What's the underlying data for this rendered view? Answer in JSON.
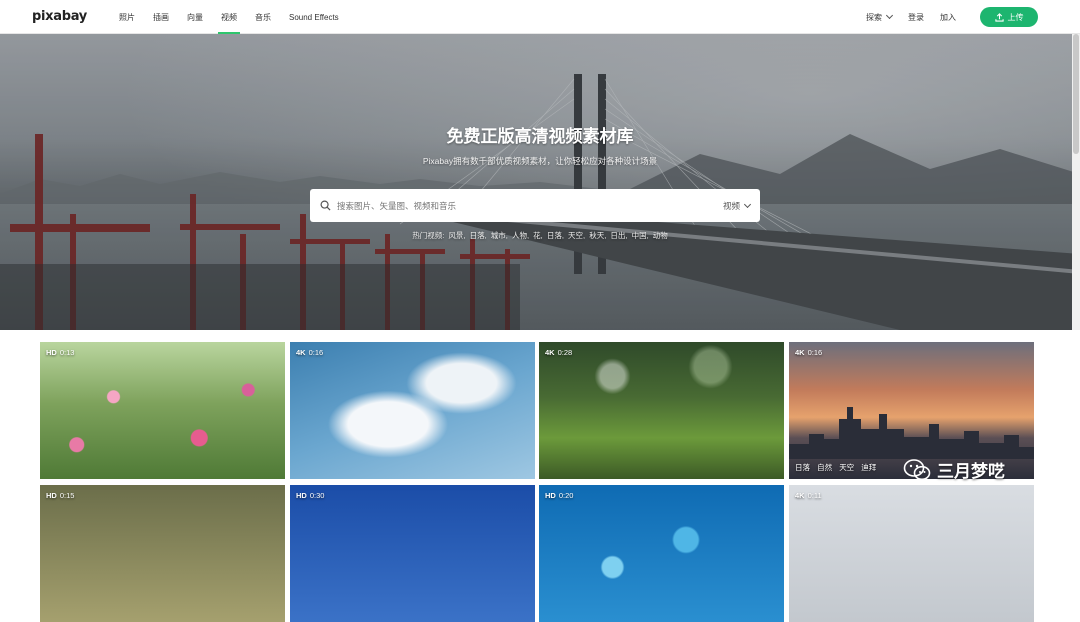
{
  "header": {
    "logo": "pixabay",
    "nav": [
      {
        "label": "照片"
      },
      {
        "label": "插画"
      },
      {
        "label": "向量"
      },
      {
        "label": "视频"
      },
      {
        "label": "音乐"
      },
      {
        "label": "Sound Effects"
      }
    ],
    "active_nav": "视频",
    "explore_label": "探索",
    "login_label": "登录",
    "join_label": "加入",
    "upload_label": "上传"
  },
  "hero": {
    "title": "免费正版高清视频素材库",
    "subtitle": "Pixabay拥有数千部优质视频素材，让你轻松应对各种设计场景",
    "search_placeholder": "搜索图片、矢量图、视频和音乐",
    "search_type": "视频",
    "popular_label": "热门视频:",
    "popular_tags": [
      "风景,",
      "日落,",
      "城市,",
      "人物,",
      "花,",
      "日落,",
      "天空,",
      "秋天,",
      "日出,",
      "中国,",
      "动物"
    ]
  },
  "videos": [
    {
      "quality": "HD",
      "duration": "0:13",
      "tags": []
    },
    {
      "quality": "4K",
      "duration": "0:16",
      "tags": []
    },
    {
      "quality": "4K",
      "duration": "0:28",
      "tags": []
    },
    {
      "quality": "4K",
      "duration": "0:16",
      "tags": [
        "日落",
        "自然",
        "天空",
        "迪拜"
      ]
    },
    {
      "quality": "HD",
      "duration": "0:15",
      "tags": []
    },
    {
      "quality": "HD",
      "duration": "0:30",
      "tags": []
    },
    {
      "quality": "HD",
      "duration": "0:20",
      "tags": []
    },
    {
      "quality": "4K",
      "duration": "0:11",
      "tags": []
    }
  ],
  "watermark": "三月梦呓",
  "colors": {
    "accent": "#1db56f",
    "active_underline": "#2ec66d"
  }
}
